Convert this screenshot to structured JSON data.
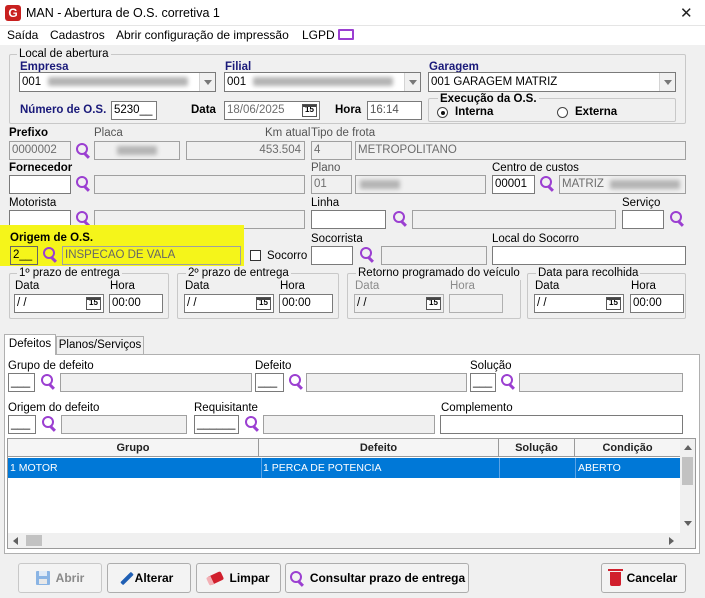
{
  "window": {
    "title": "MAN - Abertura de O.S. corretiva 1",
    "logo_letter": "G",
    "close_symbol": "✕"
  },
  "menu": [
    "Saída",
    "Cadastros",
    "Abrir configuração de impressão",
    "LGPD"
  ],
  "local_abertura": {
    "group_title": "Local de abertura",
    "empresa_label": "Empresa",
    "empresa_value": "001",
    "filial_label": "Filial",
    "filial_value": "001",
    "garagem_label": "Garagem",
    "garagem_value": "001 GARAGEM MATRIZ",
    "numero_os_label": "Número de O.S.",
    "numero_os_value": "5230__",
    "data_label": "Data",
    "data_value": "18/06/2025",
    "hora_label": "Hora",
    "hora_value": "16:14",
    "execucao_label": "Execução da O.S.",
    "execucao_options": [
      "Interna",
      "Externa"
    ],
    "execucao_selected": "Interna"
  },
  "vehicle": {
    "prefixo_label": "Prefixo",
    "prefixo_value": "0000002",
    "placa_label": "Placa",
    "km_label": "Km atual",
    "km_value": "453.504",
    "tipo_frota_label": "Tipo de frota",
    "tipo_frota_code": "4",
    "tipo_frota_value": "METROPOLITANO",
    "fornecedor_label": "Fornecedor",
    "plano_label": "Plano",
    "plano_code": "01",
    "centro_custos_label": "Centro de custos",
    "centro_custos_code": "00001",
    "centro_custos_value": "MATRIZ",
    "motorista_label": "Motorista",
    "linha_label": "Linha",
    "servico_label": "Serviço"
  },
  "origem": {
    "label": "Origem de O.S.",
    "code": "2__",
    "value": "INSPECAO DE VALA",
    "socorro_label": "Socorro",
    "socorrista_label": "Socorrista",
    "local_socorro_label": "Local do Socorro",
    "highlight_color": "#f5f51a"
  },
  "dates": [
    {
      "title": "1º prazo de entrega",
      "data_label": "Data",
      "data_value": " / /",
      "hora_label": "Hora",
      "hora_value": "00:00",
      "enabled": true
    },
    {
      "title": "2º prazo de entrega",
      "data_label": "Data",
      "data_value": " / /",
      "hora_label": "Hora",
      "hora_value": "00:00",
      "enabled": true
    },
    {
      "title": "Retorno programado do veículo",
      "data_label": "Data",
      "data_value": " / /",
      "hora_label": "Hora",
      "hora_value": "",
      "enabled": false
    },
    {
      "title": "Data para recolhida",
      "data_label": "Data",
      "data_value": " / /",
      "hora_label": "Hora",
      "hora_value": "00:00",
      "enabled": true
    }
  ],
  "calendar_icon_text": "15",
  "tabs": [
    "Defeitos",
    "Planos/Serviços"
  ],
  "defeitos": {
    "grupo_label": "Grupo de defeito",
    "defeito_label": "Defeito",
    "solucao_label": "Solução",
    "origem_label": "Origem do defeito",
    "requisitante_label": "Requisitante",
    "complemento_label": "Complemento",
    "table": {
      "columns": [
        "Grupo",
        "Defeito",
        "Solução",
        "Condição"
      ],
      "rows": [
        [
          "1 MOTOR",
          "1 PERCA DE POTENCIA",
          "",
          "ABERTO"
        ]
      ]
    }
  },
  "buttons": {
    "abrir": "Abrir",
    "alterar": "Alterar",
    "limpar": "Limpar",
    "consultar": "Consultar prazo de entrega",
    "cancelar": "Cancelar"
  },
  "colors": {
    "accent_purple": "#9b3fd1",
    "selection_blue": "#0078d7",
    "label_navy": "#1a1a7a",
    "logo_red": "#c8201f"
  }
}
